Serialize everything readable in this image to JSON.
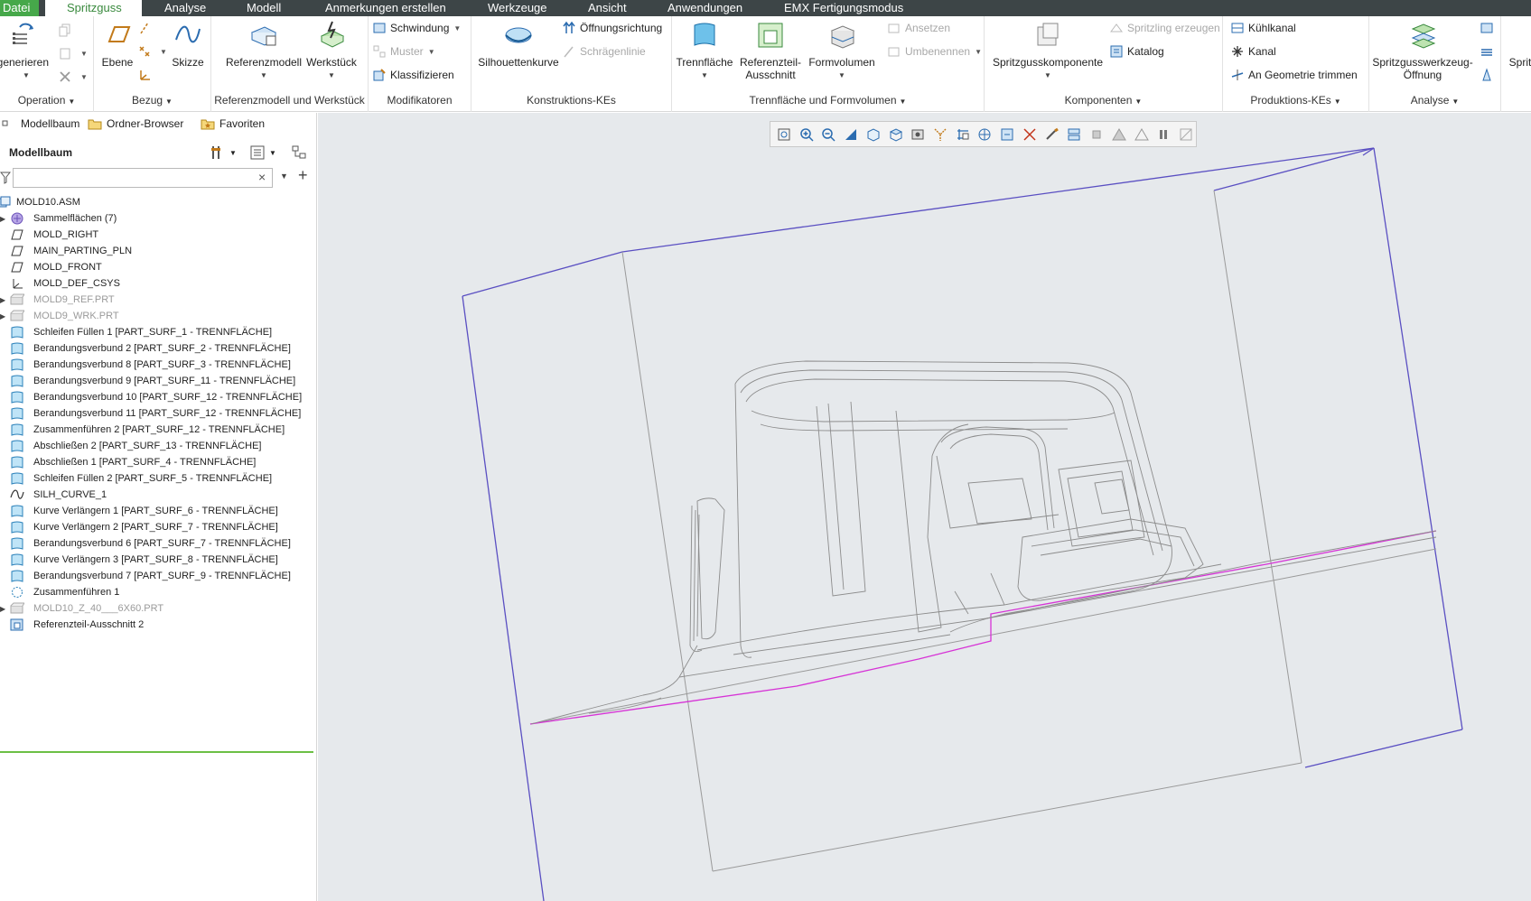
{
  "menu": {
    "tabs": [
      "Datei",
      "Spritzguss",
      "Analyse",
      "Modell",
      "Anmerkungen erstellen",
      "Werkzeuge",
      "Ansicht",
      "Anwendungen",
      "EMX Fertigungsmodus"
    ],
    "active_tab": "Spritzguss"
  },
  "ribbon": {
    "operation": {
      "label": "Operation",
      "regen": "egenerieren"
    },
    "bezug": {
      "label": "Bezug",
      "ebene": "Ebene",
      "skizze": "Skizze"
    },
    "refwerk": {
      "label": "Referenzmodell und Werkstück",
      "referenzmodell": "Referenzmodell",
      "werkstueck": "Werkstück"
    },
    "modifikatoren": {
      "label": "Modifikatoren",
      "schwindung": "Schwindung",
      "muster": "Muster",
      "klassifizieren": "Klassifizieren"
    },
    "konstruktion": {
      "label": "Konstruktions-KEs",
      "silhouettenkurve": "Silhouettenkurve",
      "oeffnungsrichtung": "Öffnungsrichtung",
      "schraeglinie": "Schrägenlinie"
    },
    "trennflaeche": {
      "label": "Trennfläche und Formvolumen",
      "trennflaeche": "Trennfläche",
      "referenzteil1": "Referenzteil-",
      "referenzteil2": "Ausschnitt",
      "formvolumen": "Formvolumen",
      "ansetzen": "Ansetzen",
      "umbenennen": "Umbenennen"
    },
    "komponenten": {
      "label": "Komponenten",
      "spritzgusskomponente": "Spritzgusskomponente",
      "spritzling": "Spritzling erzeugen",
      "katalog": "Katalog"
    },
    "produktion": {
      "label": "Produktions-KEs",
      "kuehlkanal": "Kühlkanal",
      "kanal": "Kanal",
      "geometrie": "An Geometrie trimmen"
    },
    "analyse": {
      "label": "Analyse",
      "oeffnung1": "Spritzgusswerkzeug-",
      "oeffnung2": "Öffnung",
      "partial": "Sprit"
    }
  },
  "panel": {
    "tabs": [
      "Modellbaum",
      "Ordner-Browser",
      "Favoriten"
    ],
    "tree_title": "Modellbaum",
    "filter_value": "",
    "items": [
      {
        "label": "MOLD10.ASM",
        "icon": "assembly-icon",
        "expander": "",
        "dim": false,
        "indent": 0
      },
      {
        "label": "Sammelflächen (7)",
        "icon": "quilt-group-icon",
        "expander": "▶",
        "dim": false,
        "indent": 1
      },
      {
        "label": "MOLD_RIGHT",
        "icon": "datum-plane-icon",
        "expander": "",
        "dim": false,
        "indent": 1
      },
      {
        "label": "MAIN_PARTING_PLN",
        "icon": "datum-plane-icon",
        "expander": "",
        "dim": false,
        "indent": 1
      },
      {
        "label": "MOLD_FRONT",
        "icon": "datum-plane-icon",
        "expander": "",
        "dim": false,
        "indent": 1
      },
      {
        "label": "MOLD_DEF_CSYS",
        "icon": "csys-icon",
        "expander": "",
        "dim": false,
        "indent": 1
      },
      {
        "label": "MOLD9_REF.PRT",
        "icon": "part-icon",
        "expander": "▶",
        "dim": true,
        "indent": 1
      },
      {
        "label": "MOLD9_WRK.PRT",
        "icon": "part-icon",
        "expander": "▶",
        "dim": true,
        "indent": 1
      },
      {
        "label": "Schleifen Füllen 1 [PART_SURF_1 - TRENNFLÄCHE]",
        "icon": "parting-surface-icon",
        "expander": "",
        "dim": false,
        "indent": 1
      },
      {
        "label": "Berandungsverbund 2 [PART_SURF_2 - TRENNFLÄCHE]",
        "icon": "parting-surface-icon",
        "expander": "",
        "dim": false,
        "indent": 1
      },
      {
        "label": "Berandungsverbund 8 [PART_SURF_3 - TRENNFLÄCHE]",
        "icon": "parting-surface-icon",
        "expander": "",
        "dim": false,
        "indent": 1
      },
      {
        "label": "Berandungsverbund 9 [PART_SURF_11 - TRENNFLÄCHE]",
        "icon": "parting-surface-icon",
        "expander": "",
        "dim": false,
        "indent": 1
      },
      {
        "label": "Berandungsverbund 10 [PART_SURF_12 - TRENNFLÄCHE]",
        "icon": "parting-surface-icon",
        "expander": "",
        "dim": false,
        "indent": 1
      },
      {
        "label": "Berandungsverbund 11 [PART_SURF_12 - TRENNFLÄCHE]",
        "icon": "parting-surface-icon",
        "expander": "",
        "dim": false,
        "indent": 1
      },
      {
        "label": "Zusammenführen 2 [PART_SURF_12 - TRENNFLÄCHE]",
        "icon": "parting-surface-icon",
        "expander": "",
        "dim": false,
        "indent": 1
      },
      {
        "label": "Abschließen 2 [PART_SURF_13 - TRENNFLÄCHE]",
        "icon": "parting-surface-icon",
        "expander": "",
        "dim": false,
        "indent": 1
      },
      {
        "label": "Abschließen 1 [PART_SURF_4 - TRENNFLÄCHE]",
        "icon": "parting-surface-icon",
        "expander": "",
        "dim": false,
        "indent": 1
      },
      {
        "label": "Schleifen Füllen 2 [PART_SURF_5 - TRENNFLÄCHE]",
        "icon": "parting-surface-icon",
        "expander": "",
        "dim": false,
        "indent": 1
      },
      {
        "label": "SILH_CURVE_1",
        "icon": "curve-icon",
        "expander": "",
        "dim": false,
        "indent": 1
      },
      {
        "label": "Kurve Verlängern 1 [PART_SURF_6 - TRENNFLÄCHE]",
        "icon": "parting-surface-icon",
        "expander": "",
        "dim": false,
        "indent": 1
      },
      {
        "label": "Kurve Verlängern 2 [PART_SURF_7 - TRENNFLÄCHE]",
        "icon": "parting-surface-icon",
        "expander": "",
        "dim": false,
        "indent": 1
      },
      {
        "label": "Berandungsverbund 6 [PART_SURF_7 - TRENNFLÄCHE]",
        "icon": "parting-surface-icon",
        "expander": "",
        "dim": false,
        "indent": 1
      },
      {
        "label": "Kurve Verlängern 3 [PART_SURF_8 - TRENNFLÄCHE]",
        "icon": "parting-surface-icon",
        "expander": "",
        "dim": false,
        "indent": 1
      },
      {
        "label": "Berandungsverbund 7 [PART_SURF_9 - TRENNFLÄCHE]",
        "icon": "parting-surface-icon",
        "expander": "",
        "dim": false,
        "indent": 1
      },
      {
        "label": "Zusammenführen 1",
        "icon": "merge-icon",
        "expander": "",
        "dim": false,
        "indent": 1
      },
      {
        "label": "MOLD10_Z_40___6X60.PRT",
        "icon": "part-icon",
        "expander": "▶",
        "dim": true,
        "indent": 1
      },
      {
        "label": "Referenzteil-Ausschnitt 2",
        "icon": "ref-cutout-icon",
        "expander": "",
        "dim": false,
        "indent": 1
      }
    ]
  },
  "viewport": {
    "toolbar_icons": [
      "refit-icon",
      "zoom-in-icon",
      "zoom-out-icon",
      "repaint-icon",
      "display-style-icon",
      "saved-views-icon",
      "view-manager-icon",
      "perspective-icon",
      "datum-display-icon",
      "spin-center-icon",
      "annotation-display-icon",
      "section-icon",
      "parting-line-icon",
      "mold-open-icon",
      "shrinkage-icon",
      "draft-check-icon",
      "warning-icon",
      "pause-icon",
      "slash-icon"
    ],
    "colors": {
      "bounding_box": "#5a4fc2",
      "parting_line": "#d633d6",
      "part_wire": "#8c8c8c",
      "background": "#e6e9ec"
    }
  }
}
